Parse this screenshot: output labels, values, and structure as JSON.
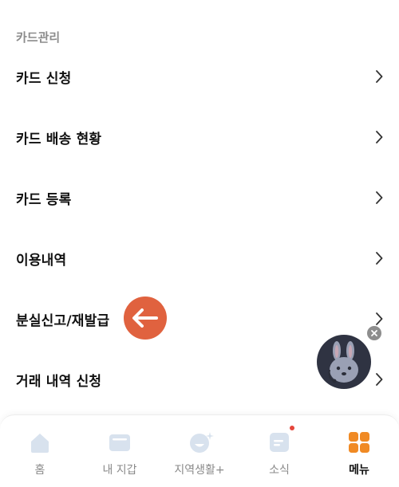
{
  "section": {
    "title": "카드관리"
  },
  "menu": {
    "items": [
      {
        "label": "카드 신청"
      },
      {
        "label": "카드 배송 현황"
      },
      {
        "label": "카드 등록"
      },
      {
        "label": "이용내역"
      },
      {
        "label": "분실신고/재발급"
      },
      {
        "label": "거래 내역 신청"
      }
    ]
  },
  "icons": {
    "chevron": "chevron-right-icon",
    "callout": "arrow-left-icon",
    "avatar": "rabbit-avatar-icon",
    "close": "close-icon"
  },
  "tabbar": {
    "tabs": [
      {
        "label": "홈",
        "icon": "home-icon"
      },
      {
        "label": "내 지갑",
        "icon": "wallet-icon"
      },
      {
        "label": "지역생활+",
        "icon": "smile-sparkle-icon"
      },
      {
        "label": "소식",
        "icon": "news-icon",
        "badge": true
      },
      {
        "label": "메뉴",
        "icon": "menu-grid-icon",
        "active": true
      }
    ]
  },
  "colors": {
    "accent_orange": "#f08a24",
    "callout_red": "#e0623f",
    "icon_inactive": "#d8e2ee",
    "badge_red": "#e5463b"
  }
}
